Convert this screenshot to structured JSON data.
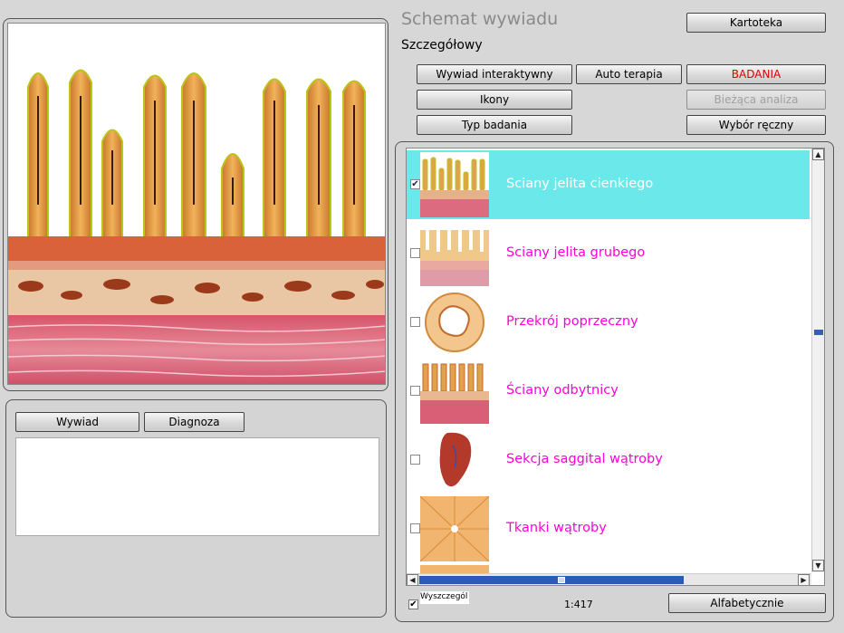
{
  "header": {
    "title": "Schemat wywiadu",
    "subtitle": "Szczegółowy"
  },
  "toolbar": {
    "kartoteka": "Kartoteka",
    "wywiad_interaktywny": "Wywiad interaktywny",
    "auto_terapia": "Auto terapia",
    "badania": "BADANIA",
    "ikony": "Ikony",
    "biezaca_analiza": "Bieżąca analiza",
    "typ_badania": "Typ badania",
    "wybor_reczny": "Wybór ręczny"
  },
  "notes": {
    "wywiad": "Wywiad",
    "diagnoza": "Diagnoza"
  },
  "list": {
    "items": [
      {
        "label": "Sciany jelita cienkiego",
        "checked": true,
        "selected": true
      },
      {
        "label": "Sciany jelita grubego",
        "checked": false,
        "selected": false
      },
      {
        "label": "Przekrój poprzeczny",
        "checked": false,
        "selected": false
      },
      {
        "label": "Ściany odbytnicy",
        "checked": false,
        "selected": false
      },
      {
        "label": "Sekcja saggital wątroby",
        "checked": false,
        "selected": false
      },
      {
        "label": "Tkanki  wątroby",
        "checked": false,
        "selected": false
      }
    ],
    "detail_label": "Wyszczegól",
    "counter": "1:417",
    "alfabetycznie": "Alfabetycznie"
  },
  "colors": {
    "selected_bg": "#6ae8ea",
    "item_text": "#ff00d8",
    "badania_text": "#e00000"
  }
}
